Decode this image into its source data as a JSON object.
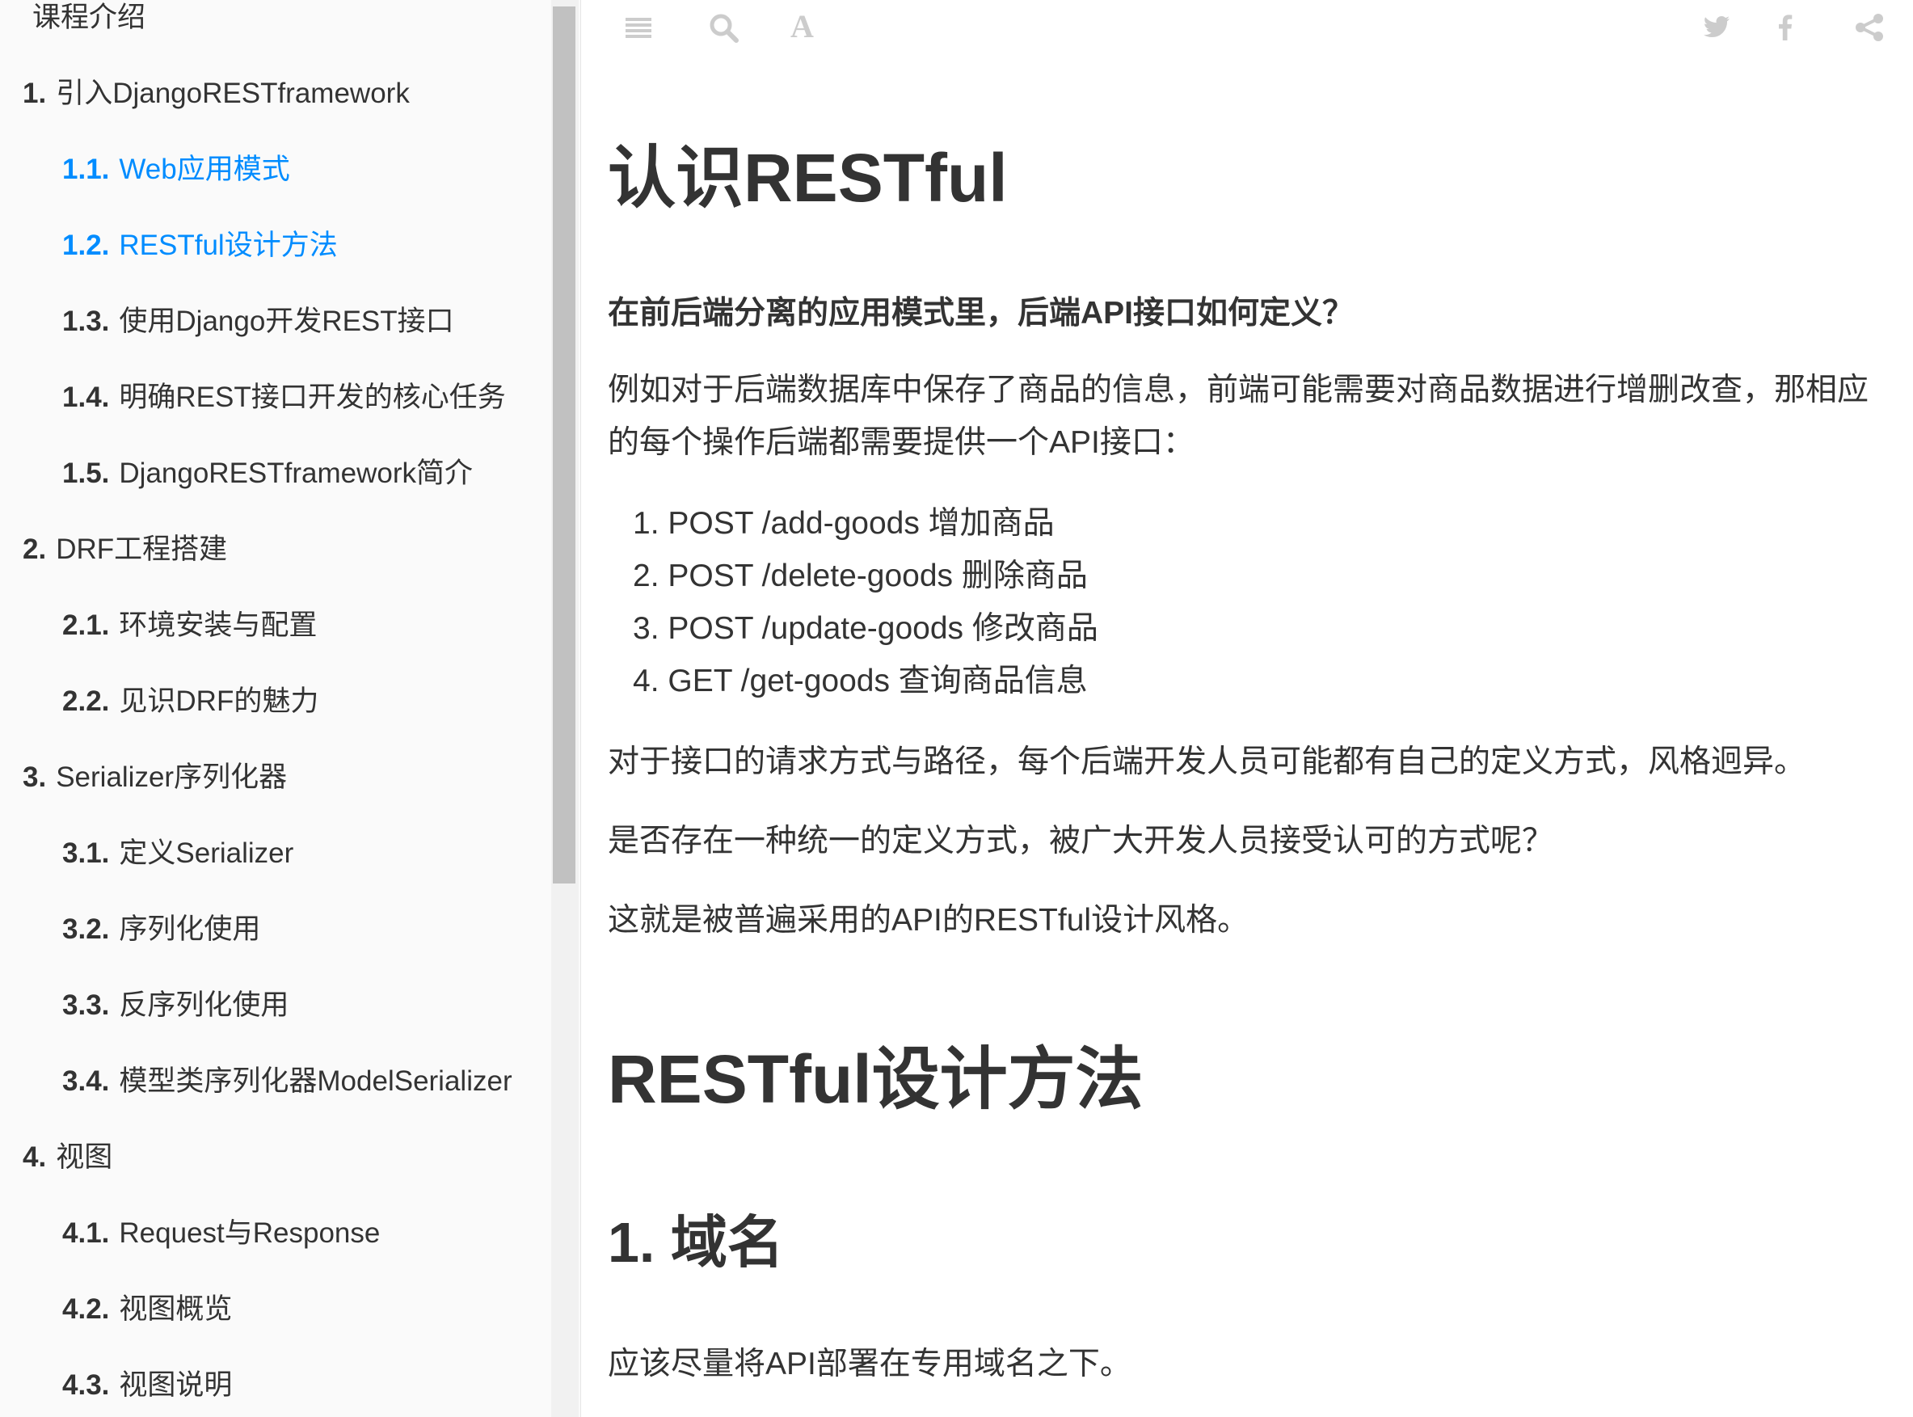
{
  "sidebar": {
    "items": [
      {
        "num": "",
        "label": "课程介绍",
        "level": 1,
        "active": false
      },
      {
        "num": "1.",
        "label": "引入DjangoRESTframework",
        "level": 1,
        "active": false
      },
      {
        "num": "1.1.",
        "label": "Web应用模式",
        "level": 2,
        "active": true
      },
      {
        "num": "1.2.",
        "label": "RESTful设计方法",
        "level": 2,
        "active": true
      },
      {
        "num": "1.3.",
        "label": "使用Django开发REST接口",
        "level": 2,
        "active": false
      },
      {
        "num": "1.4.",
        "label": "明确REST接口开发的核心任务",
        "level": 2,
        "active": false
      },
      {
        "num": "1.5.",
        "label": "DjangoRESTframework简介",
        "level": 2,
        "active": false
      },
      {
        "num": "2.",
        "label": "DRF工程搭建",
        "level": 1,
        "active": false
      },
      {
        "num": "2.1.",
        "label": "环境安装与配置",
        "level": 2,
        "active": false
      },
      {
        "num": "2.2.",
        "label": "见识DRF的魅力",
        "level": 2,
        "active": false
      },
      {
        "num": "3.",
        "label": "Serializer序列化器",
        "level": 1,
        "active": false
      },
      {
        "num": "3.1.",
        "label": "定义Serializer",
        "level": 2,
        "active": false
      },
      {
        "num": "3.2.",
        "label": "序列化使用",
        "level": 2,
        "active": false
      },
      {
        "num": "3.3.",
        "label": "反序列化使用",
        "level": 2,
        "active": false
      },
      {
        "num": "3.4.",
        "label": "模型类序列化器ModelSerializer",
        "level": 2,
        "active": false
      },
      {
        "num": "4.",
        "label": "视图",
        "level": 1,
        "active": false
      },
      {
        "num": "4.1.",
        "label": "Request与Response",
        "level": 2,
        "active": false
      },
      {
        "num": "4.2.",
        "label": "视图概览",
        "level": 2,
        "active": false
      },
      {
        "num": "4.3.",
        "label": "视图说明",
        "level": 2,
        "active": false
      }
    ]
  },
  "header": {
    "icons": [
      "menu-icon",
      "search-icon",
      "font-settings-icon",
      "twitter-icon",
      "facebook-icon",
      "share-icon"
    ],
    "font_glyph": "A"
  },
  "content": {
    "h1_restful": "认识RESTful",
    "question": "在前后端分离的应用模式里，后端API接口如何定义？",
    "intro": "例如对于后端数据库中保存了商品的信息，前端可能需要对商品数据进行增删改查，那相应的每个操作后端都需要提供一个API接口：",
    "api_list": [
      "1. POST /add-goods 增加商品",
      "2. POST /delete-goods 删除商品",
      "3. POST /update-goods 修改商品",
      "4. GET /get-goods 查询商品信息"
    ],
    "para1": "对于接口的请求方式与路径，每个后端开发人员可能都有自己的定义方式，风格迥异。",
    "para2": "是否存在一种统一的定义方式，被广大开发人员接受认可的方式呢？",
    "para3": "这就是被普遍采用的API的RESTful设计风格。",
    "h1_design": "RESTful设计方法",
    "h2_domain": "1. 域名",
    "para4": "应该尽量将API部署在专用域名之下。"
  },
  "colors": {
    "active_link": "#008cff",
    "text": "#333333",
    "sidebar_bg": "#fafafa",
    "icon": "#cccccc"
  }
}
